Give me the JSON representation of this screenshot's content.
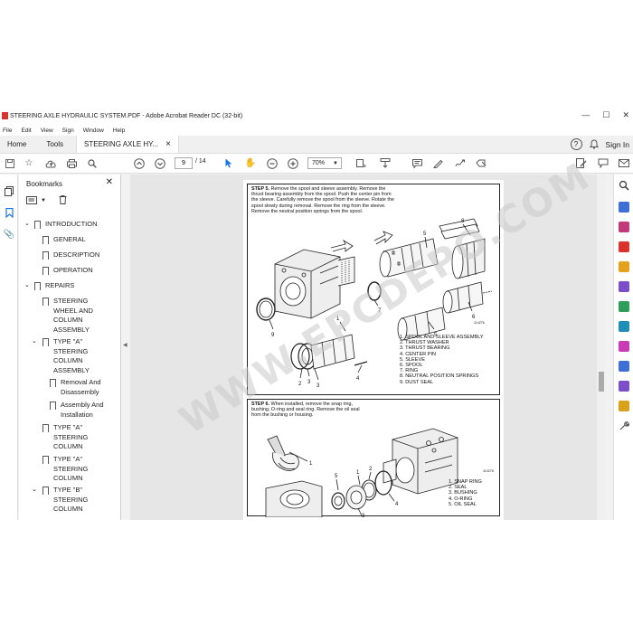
{
  "window": {
    "title": "STEERING AXLE HYDRAULIC SYSTEM.PDF - Adobe Acrobat Reader DC (32-bit)",
    "minimize": "—",
    "maximize": "☐",
    "close": "✕"
  },
  "menu": [
    "File",
    "Edit",
    "View",
    "Sign",
    "Window",
    "Help"
  ],
  "tabs": {
    "home": "Home",
    "tools": "Tools",
    "document": "STEERING AXLE HY...",
    "document_close": "×",
    "help": "?",
    "bell": "🔔",
    "signin": "Sign In"
  },
  "toolbar": {
    "page_current": "9",
    "page_separator": "/",
    "page_total": "14",
    "zoom": "70%"
  },
  "bookmarks": {
    "title": "Bookmarks",
    "close": "✕",
    "items": [
      {
        "label": "INTRODUCTION",
        "level": 0,
        "expanded": true
      },
      {
        "label": "GENERAL",
        "level": 1
      },
      {
        "label": "DESCRIPTION",
        "level": 1
      },
      {
        "label": "OPERATION",
        "level": 1
      },
      {
        "label": "REPAIRS",
        "level": 0,
        "expanded": true
      },
      {
        "label": "STEERING WHEEL AND COLUMN ASSEMBLY",
        "level": 1
      },
      {
        "label": "TYPE \"A\" STEERING COLUMN ASSEMBLY",
        "level": 1,
        "expanded": true
      },
      {
        "label": "Removal And Disassembly",
        "level": 2
      },
      {
        "label": "Assembly And Installation",
        "level": 2
      },
      {
        "label": "TYPE \"A\" STEERING COLUMN",
        "level": 1
      },
      {
        "label": "TYPE \"A\" STEERING COLUMN",
        "level": 1
      },
      {
        "label": "TYPE \"B\" STEERING COLUMN",
        "level": 1,
        "expanded": true
      }
    ]
  },
  "page": {
    "step5_label": "STEP 5.",
    "step5_text": "Remove the spool and sleeve assembly. Remove the thrust bearing assembly from the spool. Push the center pin from the sleeve. Carefully remove the spool from the sleeve. Rotate the spool slowly during removal. Remove the ring from the sleeve. Remove the neutral position springs from the spool.",
    "step5_legend": [
      "1. SPOOL AND SLEEVE ASSEMBLY",
      "2. THRUST WASHER",
      "3. THRUST BEARING",
      "4. CENTER PIN",
      "5. SLEEVE",
      "6. SPOOL",
      "7. RING",
      "8. NEUTRAL POSITION SPRINGS",
      "9. DUST SEAL"
    ],
    "step5_fig": "114276",
    "step6_label": "STEP 6.",
    "step6_text": "When installed, remove the snap ring, bushing, O-ring and seal ring. Remove the oil seal from the bushing or housing.",
    "step6_legend": [
      "1. SNAP RING",
      "2. SEAL",
      "3. BUSHING",
      "4. O-RING",
      "5. OIL SEAL"
    ],
    "step6_fig": "114278"
  },
  "watermark": "WWW.EPCDEPO.COM",
  "colors": {
    "accent_blue": "#1a73e8",
    "rail_icons": [
      "#3d6fd6",
      "#c23a7a",
      "#d9332b",
      "#e4a11b",
      "#7a4fc9",
      "#2e9e59",
      "#1f8fb5",
      "#c93bb5",
      "#3d6fd6",
      "#7a4fc9",
      "#d9a21b",
      "#555555"
    ]
  }
}
